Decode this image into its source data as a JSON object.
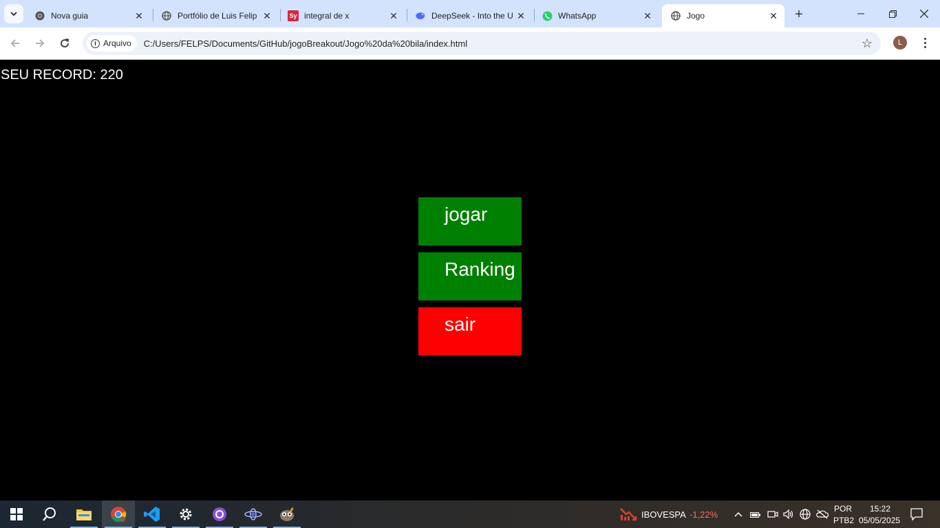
{
  "browser": {
    "tabs": [
      {
        "title": "Nova guia",
        "icon": "chrome-icon"
      },
      {
        "title": "Portfólio de Luis Felip",
        "icon": "globe-icon"
      },
      {
        "title": "integral de x",
        "icon": "symbolab-icon",
        "icon_text": "Sy"
      },
      {
        "title": "DeepSeek - Into the U",
        "icon": "deepseek-icon"
      },
      {
        "title": "WhatsApp",
        "icon": "whatsapp-icon"
      },
      {
        "title": "Jogo",
        "icon": "globe-icon",
        "active": true
      }
    ],
    "security_chip": "Arquivo",
    "url": "C:/Users/FELPS/Documents/GitHub/jogoBreakout/Jogo%20da%20bila/index.html",
    "profile_initial": "L"
  },
  "game": {
    "record_label": "SEU RECORD: 220",
    "buttons": {
      "play": "jogar",
      "ranking": "Ranking",
      "exit": "sair"
    },
    "colors": {
      "green": "#008000",
      "red": "#ff0000",
      "background": "#000000",
      "text": "#ffffff"
    }
  },
  "taskbar": {
    "ticker_name": "IBOVESPA",
    "ticker_change": "-1,22%",
    "language": "POR",
    "layout": "PTB2",
    "time": "15:22",
    "date": "05/05/2025"
  }
}
